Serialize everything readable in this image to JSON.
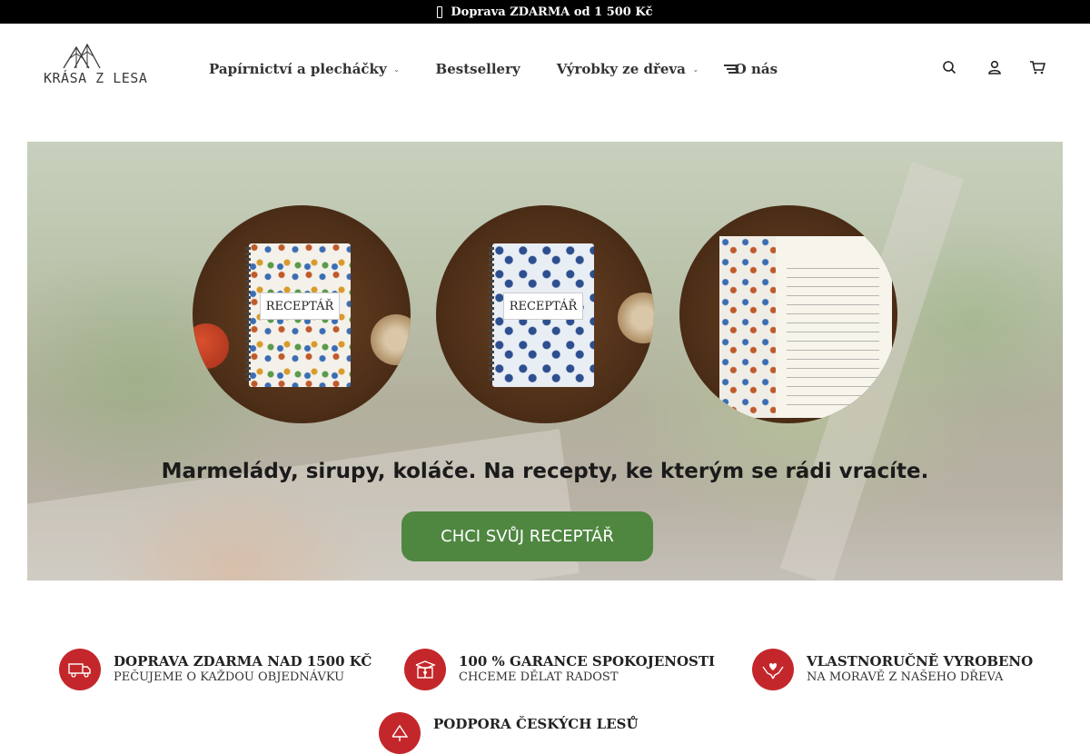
{
  "announcement": {
    "text": "Doprava ZDARMA od 1 500 Kč",
    "icon": "phone-icon"
  },
  "logo": {
    "text": "KRÁSA Z LESA",
    "icon": "tree-icon"
  },
  "nav": {
    "items": [
      {
        "label": "Papírnictví a plecháčky",
        "has_dropdown": true
      },
      {
        "label": "Bestsellery",
        "has_dropdown": false
      },
      {
        "label": "Výrobky ze dřeva",
        "has_dropdown": true
      },
      {
        "label": "O nás",
        "has_dropdown": false
      }
    ],
    "caret_glyph": "⌄",
    "more_icon": "menu-lines-icon"
  },
  "header_icons": [
    "search-icon",
    "user-icon",
    "cart-icon"
  ],
  "hero": {
    "books": [
      {
        "label": "RECEPTÁŘ",
        "style": "floral-colorful"
      },
      {
        "label": "RECEPTÁŘ",
        "style": "floral-blue"
      },
      {
        "label": "",
        "style": "open-notebook"
      }
    ],
    "headline": "Marmelády, sirupy, koláče. Na recepty, ke kterým se rádi vracíte.",
    "cta_label": "CHCI SVŮJ RECEPTÁŘ",
    "cta_color": "#4f8741"
  },
  "features": [
    {
      "title": "DOPRAVA ZDARMA NAD 1500 KČ",
      "subtitle": "PEČUJEME O KAŽDOU OBJEDNÁVKU",
      "icon": "truck-icon"
    },
    {
      "title": "100 % GARANCE SPOKOJENOSTI",
      "subtitle": "CHCEME DĚLAT RADOST",
      "icon": "gift-box-icon"
    },
    {
      "title": "VLASTNORUČNĚ VYROBENO",
      "subtitle": "NA MORAVĚ Z NAŠEHO DŘEVA",
      "icon": "hands-heart-icon"
    },
    {
      "title": "PODPORA ČESKÝCH LESŮ",
      "subtitle": "",
      "icon": "tree-icon"
    }
  ],
  "colors": {
    "accent_red": "#c4272b",
    "cta_green": "#4f8741",
    "topbar": "#000000"
  }
}
